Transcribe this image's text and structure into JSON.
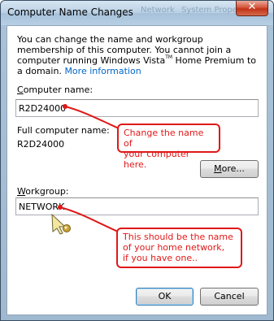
{
  "window": {
    "title": "Computer Name Changes",
    "ghost_title_1": "Network",
    "ghost_title_2": "System Properties"
  },
  "intro": {
    "text_1": "You can change the name and workgroup membership of this computer. You cannot join a computer running Windows Vista",
    "tm": "TM",
    "text_2": " Home Premium to a domain.",
    "link": "More information"
  },
  "computer_name": {
    "label_prefix": "",
    "label_access": "C",
    "label_rest": "omputer name:",
    "value": "R2D24000"
  },
  "full_computer_name": {
    "label": "Full computer name:",
    "value": "R2D24000"
  },
  "more_button": {
    "access": "M",
    "rest": "ore..."
  },
  "workgroup": {
    "label_access": "W",
    "label_rest": "orkgroup:",
    "value": "NETWORK"
  },
  "ok_button": {
    "label": "OK"
  },
  "cancel_button": {
    "label": "Cancel"
  },
  "callouts": {
    "computer_name_line_1": "Change the name of",
    "computer_name_line_2": "your computer here.",
    "workgroup_line_1": "This should be the name",
    "workgroup_line_2": "of your home network,",
    "workgroup_line_3": "if you have one.."
  },
  "colors": {
    "annotation_red": "#e01818",
    "link_blue": "#0066cc"
  },
  "icons": {
    "close": "close-icon",
    "cursor": "arrow-cursor-icon"
  }
}
